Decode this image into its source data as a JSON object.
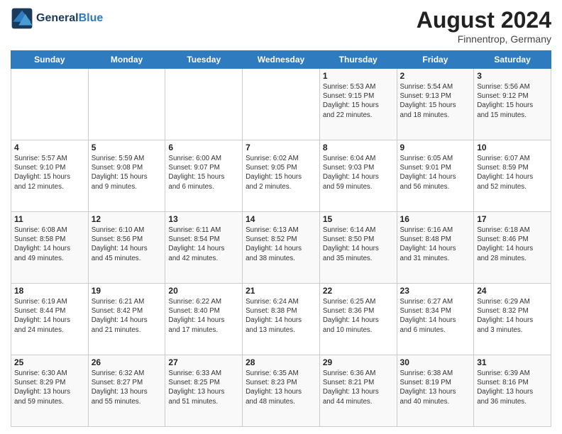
{
  "header": {
    "logo_line1": "General",
    "logo_line2": "Blue",
    "month_title": "August 2024",
    "location": "Finnentrop, Germany"
  },
  "days_of_week": [
    "Sunday",
    "Monday",
    "Tuesday",
    "Wednesday",
    "Thursday",
    "Friday",
    "Saturday"
  ],
  "weeks": [
    [
      {
        "day": "",
        "info": ""
      },
      {
        "day": "",
        "info": ""
      },
      {
        "day": "",
        "info": ""
      },
      {
        "day": "",
        "info": ""
      },
      {
        "day": "1",
        "info": "Sunrise: 5:53 AM\nSunset: 9:15 PM\nDaylight: 15 hours\nand 22 minutes."
      },
      {
        "day": "2",
        "info": "Sunrise: 5:54 AM\nSunset: 9:13 PM\nDaylight: 15 hours\nand 18 minutes."
      },
      {
        "day": "3",
        "info": "Sunrise: 5:56 AM\nSunset: 9:12 PM\nDaylight: 15 hours\nand 15 minutes."
      }
    ],
    [
      {
        "day": "4",
        "info": "Sunrise: 5:57 AM\nSunset: 9:10 PM\nDaylight: 15 hours\nand 12 minutes."
      },
      {
        "day": "5",
        "info": "Sunrise: 5:59 AM\nSunset: 9:08 PM\nDaylight: 15 hours\nand 9 minutes."
      },
      {
        "day": "6",
        "info": "Sunrise: 6:00 AM\nSunset: 9:07 PM\nDaylight: 15 hours\nand 6 minutes."
      },
      {
        "day": "7",
        "info": "Sunrise: 6:02 AM\nSunset: 9:05 PM\nDaylight: 15 hours\nand 2 minutes."
      },
      {
        "day": "8",
        "info": "Sunrise: 6:04 AM\nSunset: 9:03 PM\nDaylight: 14 hours\nand 59 minutes."
      },
      {
        "day": "9",
        "info": "Sunrise: 6:05 AM\nSunset: 9:01 PM\nDaylight: 14 hours\nand 56 minutes."
      },
      {
        "day": "10",
        "info": "Sunrise: 6:07 AM\nSunset: 8:59 PM\nDaylight: 14 hours\nand 52 minutes."
      }
    ],
    [
      {
        "day": "11",
        "info": "Sunrise: 6:08 AM\nSunset: 8:58 PM\nDaylight: 14 hours\nand 49 minutes."
      },
      {
        "day": "12",
        "info": "Sunrise: 6:10 AM\nSunset: 8:56 PM\nDaylight: 14 hours\nand 45 minutes."
      },
      {
        "day": "13",
        "info": "Sunrise: 6:11 AM\nSunset: 8:54 PM\nDaylight: 14 hours\nand 42 minutes."
      },
      {
        "day": "14",
        "info": "Sunrise: 6:13 AM\nSunset: 8:52 PM\nDaylight: 14 hours\nand 38 minutes."
      },
      {
        "day": "15",
        "info": "Sunrise: 6:14 AM\nSunset: 8:50 PM\nDaylight: 14 hours\nand 35 minutes."
      },
      {
        "day": "16",
        "info": "Sunrise: 6:16 AM\nSunset: 8:48 PM\nDaylight: 14 hours\nand 31 minutes."
      },
      {
        "day": "17",
        "info": "Sunrise: 6:18 AM\nSunset: 8:46 PM\nDaylight: 14 hours\nand 28 minutes."
      }
    ],
    [
      {
        "day": "18",
        "info": "Sunrise: 6:19 AM\nSunset: 8:44 PM\nDaylight: 14 hours\nand 24 minutes."
      },
      {
        "day": "19",
        "info": "Sunrise: 6:21 AM\nSunset: 8:42 PM\nDaylight: 14 hours\nand 21 minutes."
      },
      {
        "day": "20",
        "info": "Sunrise: 6:22 AM\nSunset: 8:40 PM\nDaylight: 14 hours\nand 17 minutes."
      },
      {
        "day": "21",
        "info": "Sunrise: 6:24 AM\nSunset: 8:38 PM\nDaylight: 14 hours\nand 13 minutes."
      },
      {
        "day": "22",
        "info": "Sunrise: 6:25 AM\nSunset: 8:36 PM\nDaylight: 14 hours\nand 10 minutes."
      },
      {
        "day": "23",
        "info": "Sunrise: 6:27 AM\nSunset: 8:34 PM\nDaylight: 14 hours\nand 6 minutes."
      },
      {
        "day": "24",
        "info": "Sunrise: 6:29 AM\nSunset: 8:32 PM\nDaylight: 14 hours\nand 3 minutes."
      }
    ],
    [
      {
        "day": "25",
        "info": "Sunrise: 6:30 AM\nSunset: 8:29 PM\nDaylight: 13 hours\nand 59 minutes."
      },
      {
        "day": "26",
        "info": "Sunrise: 6:32 AM\nSunset: 8:27 PM\nDaylight: 13 hours\nand 55 minutes."
      },
      {
        "day": "27",
        "info": "Sunrise: 6:33 AM\nSunset: 8:25 PM\nDaylight: 13 hours\nand 51 minutes."
      },
      {
        "day": "28",
        "info": "Sunrise: 6:35 AM\nSunset: 8:23 PM\nDaylight: 13 hours\nand 48 minutes."
      },
      {
        "day": "29",
        "info": "Sunrise: 6:36 AM\nSunset: 8:21 PM\nDaylight: 13 hours\nand 44 minutes."
      },
      {
        "day": "30",
        "info": "Sunrise: 6:38 AM\nSunset: 8:19 PM\nDaylight: 13 hours\nand 40 minutes."
      },
      {
        "day": "31",
        "info": "Sunrise: 6:39 AM\nSunset: 8:16 PM\nDaylight: 13 hours\nand 36 minutes."
      }
    ]
  ]
}
